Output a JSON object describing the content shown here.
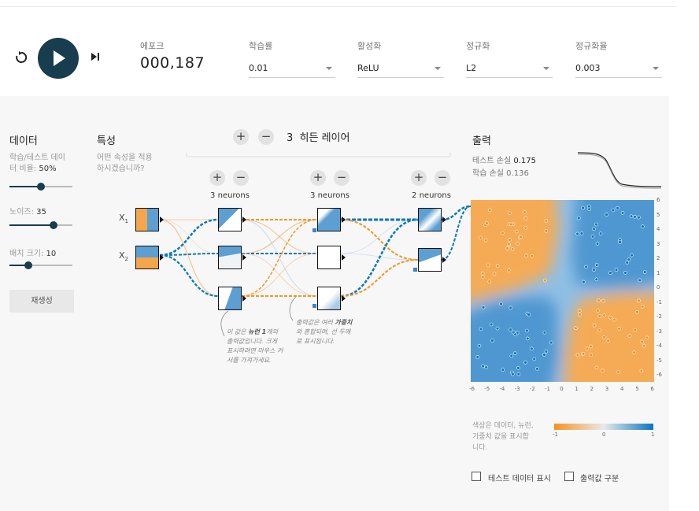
{
  "controls": {
    "epoch": {
      "label": "에포크",
      "value": "000,187"
    },
    "learning_rate": {
      "label": "학습률",
      "value": "0.01"
    },
    "activation": {
      "label": "활성화",
      "value": "ReLU"
    },
    "regularization": {
      "label": "정규화",
      "value": "L2"
    },
    "reg_rate": {
      "label": "정규화율",
      "value": "0.003"
    }
  },
  "data_panel": {
    "title": "데이터",
    "ratio_label": "학습/테스트 데이\n터 비율:",
    "ratio_value": "50%",
    "ratio_fraction": 0.5,
    "noise_label": "노이즈:",
    "noise_value": "35",
    "noise_fraction": 0.7,
    "batch_label": "배치 크기:",
    "batch_value": "10",
    "batch_fraction": 0.3,
    "regenerate_label": "재생성"
  },
  "features_panel": {
    "title": "특성",
    "subtitle": "어떤 속성을 적용\n하시겠습니까?",
    "x1": "X",
    "x2": "X",
    "sub1": "1",
    "sub2": "2"
  },
  "network": {
    "plus": "+",
    "minus": "−",
    "hidden_count": "3",
    "hidden_label": "히든 레이어",
    "layers": [
      {
        "neurons_label": "3 neurons"
      },
      {
        "neurons_label": "3 neurons"
      },
      {
        "neurons_label": "2 neurons"
      }
    ],
    "callout_left_a": "이 값은 ",
    "callout_left_b": "뉴런 1",
    "callout_left_c": "개의\n출력값입니다. 크게\n표시하려면 마우스 커\n서를 가져가세요.",
    "callout_right_a": "출력값은 여러 ",
    "callout_right_b": "가중치",
    "callout_right_c": "\n와 혼합되며, 선 두께\n로 표시됩니다."
  },
  "output_panel": {
    "title": "출력",
    "test_loss_label": "테스트 손실",
    "test_loss_value": "0.175",
    "train_loss_label": "학습 손실",
    "train_loss_value": "0.136",
    "y_ticks": [
      "6",
      "5",
      "4",
      "3",
      "2",
      "1",
      "0",
      "-1",
      "-2",
      "-3",
      "-4",
      "-5",
      "-6"
    ],
    "x_ticks": [
      "-6",
      "-5",
      "-4",
      "-3",
      "-2",
      "-1",
      "0",
      "1",
      "2",
      "3",
      "4",
      "5",
      "6"
    ],
    "legend_text": "색상은 데이터, 뉴런,\n가중치 값을 표시합\n니다.",
    "legend_ticks": [
      "-1",
      "0",
      "1"
    ],
    "show_test_label": "테스트 데이터 표시",
    "discretize_label": "출력값 구분"
  },
  "colors": {
    "orange": "#f59322",
    "blue": "#0877bd",
    "dark": "#183d4e"
  }
}
